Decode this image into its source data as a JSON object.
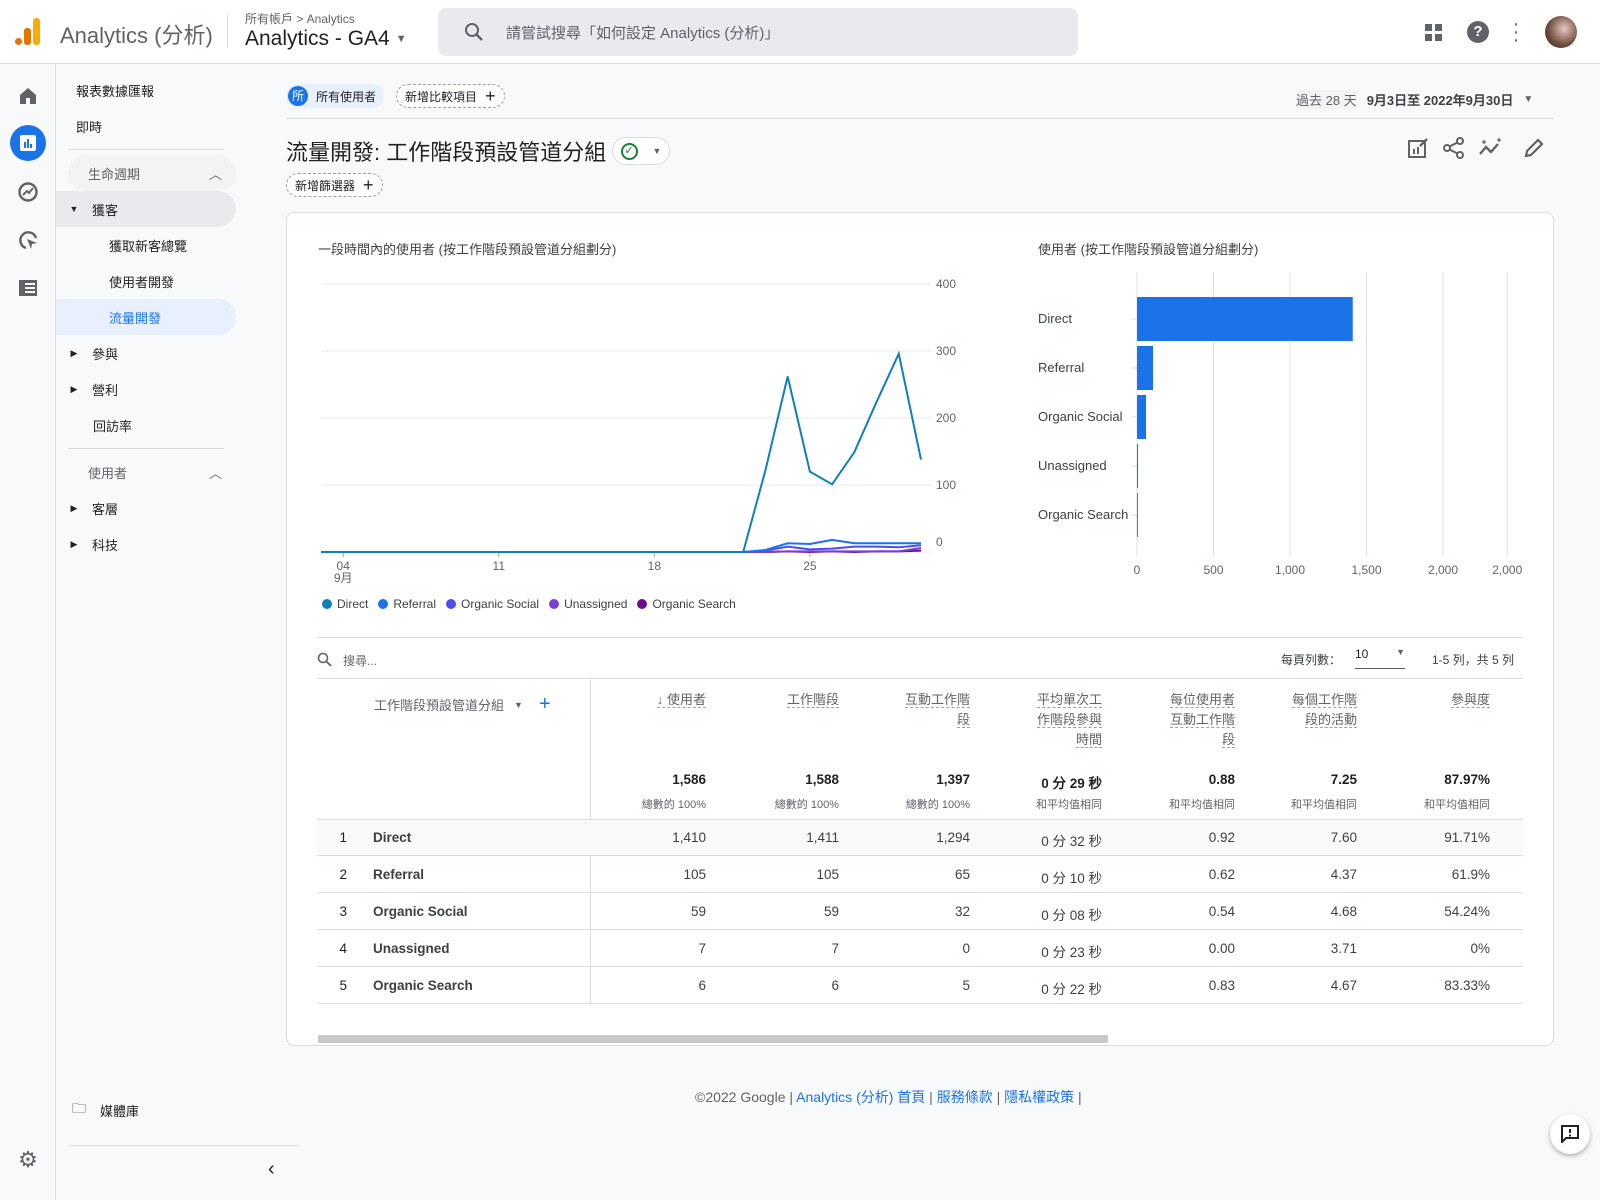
{
  "header": {
    "product": "Analytics (分析)",
    "breadcrumb": "所有帳戶 > Analytics",
    "property": "Analytics - GA4",
    "search_placeholder": "請嘗試搜尋「如何設定 Analytics (分析)」",
    "icons": [
      "apps-icon",
      "help-icon",
      "more-vert-icon",
      "avatar"
    ]
  },
  "rail": {
    "icons": [
      "home-icon",
      "reports-icon",
      "explore-icon",
      "advertising-icon",
      "configure-icon"
    ]
  },
  "nav": {
    "top": [
      "報表數據匯報",
      "即時"
    ],
    "lifecycle": {
      "label": "生命週期",
      "items": [
        {
          "label": "獲客",
          "expanded": true
        },
        {
          "label": "獲取新客總覽"
        },
        {
          "label": "使用者開發"
        },
        {
          "label": "流量開發",
          "active": true
        },
        {
          "label": "參與"
        },
        {
          "label": "營利"
        },
        {
          "label": "回訪率"
        }
      ]
    },
    "user": {
      "label": "使用者",
      "items": [
        {
          "label": "客層"
        },
        {
          "label": "科技"
        }
      ]
    },
    "library": "媒體庫"
  },
  "toolbar": {
    "segment_avatar": "所",
    "segment": "所有使用者",
    "add_comparison": "新增比較項目",
    "date_label": "過去 28 天",
    "date_range": "9月3日至 2022年9月30日",
    "title": "流量開發: 工作階段預設管道分組",
    "add_filter": "新增篩選器"
  },
  "chart_data": [
    {
      "type": "line",
      "title": "一段時間內的使用者 (按工作階段預設管道分組劃分)",
      "x": [
        "09-03",
        "09-04",
        "09-05",
        "09-06",
        "09-07",
        "09-08",
        "09-09",
        "09-10",
        "09-11",
        "09-12",
        "09-13",
        "09-14",
        "09-15",
        "09-16",
        "09-17",
        "09-18",
        "09-19",
        "09-20",
        "09-21",
        "09-22",
        "09-23",
        "09-24",
        "09-25",
        "09-26",
        "09-27",
        "09-28",
        "09-29",
        "09-30"
      ],
      "x_ticks": [
        {
          "x": "09-04",
          "label": "04",
          "sub": "9月"
        },
        {
          "x": "09-11",
          "label": "11"
        },
        {
          "x": "09-18",
          "label": "18"
        },
        {
          "x": "09-25",
          "label": "25"
        }
      ],
      "y_ticks": [
        0,
        100,
        200,
        300,
        400
      ],
      "ylim": [
        0,
        400
      ],
      "grid": true,
      "legend": "bottom-left",
      "series": [
        {
          "name": "Direct",
          "color": "#0f7fb8",
          "values": [
            0,
            0,
            0,
            0,
            0,
            0,
            0,
            0,
            0,
            0,
            0,
            0,
            0,
            0,
            0,
            0,
            0,
            0,
            0,
            0,
            122,
            262,
            120,
            101,
            149,
            224,
            296,
            138
          ]
        },
        {
          "name": "Referral",
          "color": "#1a73e8",
          "values": [
            0,
            0,
            0,
            0,
            0,
            0,
            0,
            0,
            0,
            0,
            0,
            0,
            0,
            0,
            0,
            0,
            0,
            0,
            0,
            0,
            3,
            13,
            12,
            18,
            13,
            13,
            13,
            13
          ]
        },
        {
          "name": "Organic Social",
          "color": "#4b4ee8",
          "values": [
            0,
            0,
            0,
            0,
            0,
            0,
            0,
            0,
            0,
            0,
            0,
            0,
            0,
            0,
            0,
            0,
            0,
            0,
            0,
            0,
            2,
            8,
            4,
            5,
            8,
            8,
            7,
            10
          ]
        },
        {
          "name": "Unassigned",
          "color": "#7b3fd3",
          "values": [
            0,
            0,
            0,
            0,
            0,
            0,
            0,
            0,
            0,
            0,
            0,
            0,
            0,
            0,
            0,
            0,
            0,
            0,
            0,
            0,
            0,
            1,
            1,
            1,
            1,
            1,
            1,
            6
          ]
        },
        {
          "name": "Organic Search",
          "color": "#6a0d91",
          "values": [
            0,
            0,
            0,
            0,
            0,
            0,
            0,
            0,
            0,
            0,
            0,
            0,
            0,
            0,
            0,
            0,
            0,
            0,
            0,
            0,
            0,
            1,
            0,
            1,
            0,
            1,
            1,
            2
          ]
        }
      ]
    },
    {
      "type": "bar",
      "orientation": "horizontal",
      "title": "使用者 (按工作階段預設管道分組劃分)",
      "color": "#1a73e8",
      "categories": [
        "Direct",
        "Referral",
        "Organic Social",
        "Unassigned",
        "Organic Search"
      ],
      "values": [
        1410,
        105,
        59,
        7,
        6
      ],
      "x_ticks": [
        {
          "v": 0,
          "label": "0"
        },
        {
          "v": 500,
          "label": "500"
        },
        {
          "v": 1000,
          "label": "1,000"
        },
        {
          "v": 1500,
          "label": "1,500"
        },
        {
          "v": 2000,
          "label": "2,000"
        },
        {
          "v": 2420,
          "label": "2,000"
        }
      ],
      "xlim": [
        0,
        2420
      ],
      "grid": true
    }
  ],
  "table": {
    "search_placeholder": "搜尋...",
    "rows_per_page_label": "每頁列數：",
    "rows_per_page": "10",
    "pagination": "1-5 列，共 5 列",
    "dim_header": "工作階段預設管道分組",
    "columns": [
      {
        "label": [
          "↓ 使用者"
        ],
        "total": "1,586",
        "sub": "總數的 100%"
      },
      {
        "label": [
          "工作階段"
        ],
        "total": "1,588",
        "sub": "總數的 100%"
      },
      {
        "label": [
          "互動工作階",
          "段"
        ],
        "total": "1,397",
        "sub": "總數的 100%"
      },
      {
        "label": [
          "平均單次工",
          "作階段參與",
          "時間"
        ],
        "total": "0 分 29 秒",
        "sub": "和平均值相同"
      },
      {
        "label": [
          "每位使用者",
          "互動工作階",
          "段"
        ],
        "total": "0.88",
        "sub": "和平均值相同"
      },
      {
        "label": [
          "每個工作階",
          "段的活動"
        ],
        "total": "7.25",
        "sub": "和平均值相同"
      },
      {
        "label": [
          "參與度"
        ],
        "total": "87.97%",
        "sub": "和平均值相同"
      }
    ],
    "rows": [
      {
        "n": "1",
        "name": "Direct",
        "v": [
          "1,410",
          "1,411",
          "1,294",
          "0 分 32 秒",
          "0.92",
          "7.60",
          "91.71%"
        ]
      },
      {
        "n": "2",
        "name": "Referral",
        "v": [
          "105",
          "105",
          "65",
          "0 分 10 秒",
          "0.62",
          "4.37",
          "61.9%"
        ]
      },
      {
        "n": "3",
        "name": "Organic Social",
        "v": [
          "59",
          "59",
          "32",
          "0 分 08 秒",
          "0.54",
          "4.68",
          "54.24%"
        ]
      },
      {
        "n": "4",
        "name": "Unassigned",
        "v": [
          "7",
          "7",
          "0",
          "0 分 23 秒",
          "0.00",
          "3.71",
          "0%"
        ]
      },
      {
        "n": "5",
        "name": "Organic Search",
        "v": [
          "6",
          "6",
          "5",
          "0 分 22 秒",
          "0.83",
          "4.67",
          "83.33%"
        ]
      }
    ]
  },
  "footer": {
    "copyright": "©2022 Google |",
    "home": "Analytics (分析) 首頁",
    "sep": "|",
    "terms": "服務條款",
    "privacy": "隱私權政策"
  }
}
